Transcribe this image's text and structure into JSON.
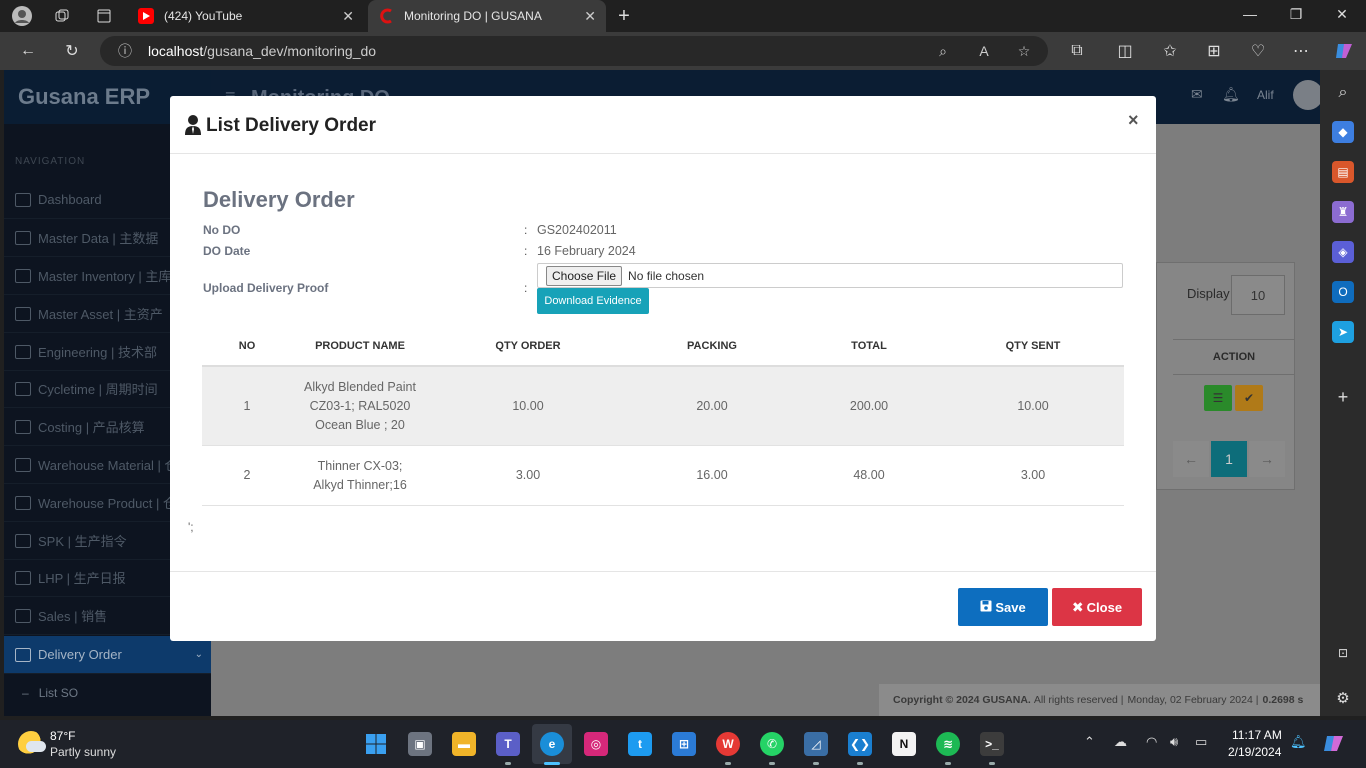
{
  "browser": {
    "tabs": [
      {
        "title": "(424) YouTube"
      },
      {
        "title": "Monitoring DO | GUSANA"
      }
    ],
    "url_host": "localhost",
    "url_path": "/gusana_dev/monitoring_do"
  },
  "app": {
    "brand": "Gusana ERP",
    "page_title": "Monitoring DO",
    "nav_heading": "NAVIGATION",
    "user_name": "Alif",
    "menu": [
      {
        "label": "Dashboard"
      },
      {
        "label": "Master Data | 主数据"
      },
      {
        "label": "Master Inventory | 主库"
      },
      {
        "label": "Master Asset | 主资产"
      },
      {
        "label": "Engineering | 技术部"
      },
      {
        "label": "Cycletime | 周期时间"
      },
      {
        "label": "Costing | 产品核算"
      },
      {
        "label": "Warehouse Material | 仓"
      },
      {
        "label": "Warehouse Product | 仓"
      },
      {
        "label": "SPK | 生产指令"
      },
      {
        "label": "LHP | 生产日报"
      },
      {
        "label": "Sales | 销售"
      },
      {
        "label": "Delivery Order"
      }
    ],
    "submenu": {
      "label": "List SO"
    },
    "display_label": "Display",
    "display_value": "10",
    "action_header": "ACTION",
    "current_page": "1",
    "footer": {
      "copyright": "Copyright © 2024 GUSANA.",
      "rights": "All rights reserved |",
      "date": "Monday, 02 February 2024 |",
      "time": "0.2698 s"
    }
  },
  "modal": {
    "title": "List Delivery Order",
    "section_title": "Delivery Order",
    "fields": {
      "no_do_label": "No DO",
      "no_do_value": "GS202402011",
      "do_date_label": "DO Date",
      "do_date_value": "16 February 2024",
      "upload_label": "Upload Delivery Proof",
      "colon": ":"
    },
    "file_button": "Choose File",
    "file_status": "No file chosen",
    "download_button": "Download Evidence",
    "table": {
      "headers": [
        "NO",
        "PRODUCT NAME",
        "QTY ORDER",
        "PACKING",
        "TOTAL",
        "QTY SENT"
      ],
      "rows": [
        {
          "no": "1",
          "product_lines": [
            "Alkyd Blended Paint",
            "CZ03-1; RAL5020",
            "Ocean Blue ; 20"
          ],
          "qty_order": "10.00",
          "packing": "20.00",
          "total": "200.00",
          "qty_sent": "10.00"
        },
        {
          "no": "2",
          "product_lines": [
            "Thinner CX-03;",
            "Alkyd Thinner;16"
          ],
          "qty_order": "3.00",
          "packing": "16.00",
          "total": "48.00",
          "qty_sent": "3.00"
        }
      ]
    },
    "stray_text": "';",
    "save_label": "Save",
    "close_label": "Close",
    "close_x": "×"
  },
  "taskbar": {
    "temperature": "87°F",
    "weather": "Partly sunny",
    "time": "11:17 AM",
    "date": "2/19/2024"
  },
  "colors": {
    "save": "#0d6ebf",
    "close": "#dc3545",
    "download": "#17a2b8",
    "active_menu": "#0d3a6b"
  }
}
